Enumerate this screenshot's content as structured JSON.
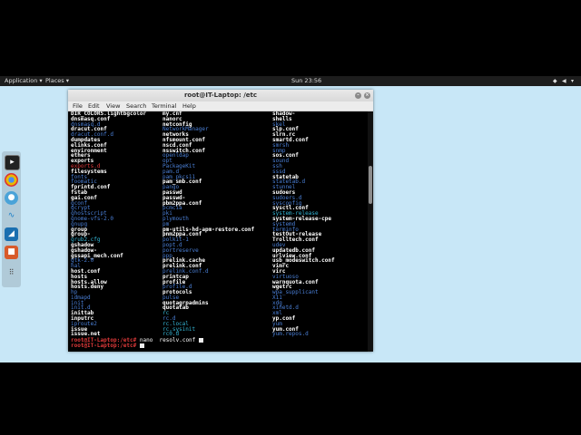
{
  "topbar": {
    "applications": "Application ▾",
    "places": "Places ▾",
    "clock": "Sun 23:56"
  },
  "dock": {
    "icons": [
      "terminal-icon",
      "chrome-icon",
      "app-icon",
      "wave-icon",
      "kali-icon",
      "app2-icon",
      "grid-icon"
    ]
  },
  "window": {
    "title": "root@IT-Laptop: /etc"
  },
  "menu": {
    "file": "File",
    "edit": "Edit",
    "view": "View",
    "search": "Search",
    "terminal": "Terminal",
    "help": "Help"
  },
  "columns": {
    "c1": [
      {
        "t": "DIR_COLORS.lightbgcolor",
        "s": "bold"
      },
      {
        "t": "dnsmasq.conf",
        "s": "bold"
      },
      {
        "t": "dnsmasq.d",
        "s": "blue"
      },
      {
        "t": "dracut.conf",
        "s": "bold"
      },
      {
        "t": "dracut.conf.d",
        "s": "blue"
      },
      {
        "t": "dumpdates",
        "s": "bold"
      },
      {
        "t": "elinks.conf",
        "s": "bold"
      },
      {
        "t": "environment",
        "s": "bold"
      },
      {
        "t": "ethers",
        "s": "bold"
      },
      {
        "t": "exports",
        "s": "bold"
      },
      {
        "t": "exports.d",
        "s": "red"
      },
      {
        "t": "filesystems",
        "s": "bold"
      },
      {
        "t": "fonts",
        "s": "blue"
      },
      {
        "t": "foomatic",
        "s": "blue"
      },
      {
        "t": "fprintd.conf",
        "s": "bold"
      },
      {
        "t": "fstab",
        "s": "bold"
      },
      {
        "t": "gai.conf",
        "s": "bold"
      },
      {
        "t": "gconf",
        "s": "blue"
      },
      {
        "t": "gcrypt",
        "s": "blue"
      },
      {
        "t": "ghostscript",
        "s": "blue"
      },
      {
        "t": "gnome-vfs-2.0",
        "s": "blue"
      },
      {
        "t": "gnupg",
        "s": "blue"
      },
      {
        "t": "group",
        "s": "bold"
      },
      {
        "t": "group-",
        "s": "bold"
      },
      {
        "t": "grub2.cfg",
        "s": "cyan"
      },
      {
        "t": "gshadow",
        "s": "bold"
      },
      {
        "t": "gshadow-",
        "s": "bold"
      },
      {
        "t": "gssapi_mech.conf",
        "s": "bold"
      },
      {
        "t": "gtk-2.0",
        "s": "blue"
      },
      {
        "t": "hal",
        "s": "blue"
      },
      {
        "t": "host.conf",
        "s": "bold"
      },
      {
        "t": "hosts",
        "s": "bold"
      },
      {
        "t": "hosts.allow",
        "s": "bold"
      },
      {
        "t": "hosts.deny",
        "s": "bold"
      },
      {
        "t": "hp",
        "s": "blue"
      },
      {
        "t": "idmapd",
        "s": "blue"
      },
      {
        "t": "init",
        "s": "blue"
      },
      {
        "t": "init.d",
        "s": "blue"
      },
      {
        "t": "inittab",
        "s": "bold"
      },
      {
        "t": "inputrc",
        "s": "bold"
      },
      {
        "t": "iproute2",
        "s": "blue"
      },
      {
        "t": "issue",
        "s": "bold"
      },
      {
        "t": "issue.net",
        "s": "bold"
      }
    ],
    "c2": [
      {
        "t": "my.cnf",
        "s": "bold"
      },
      {
        "t": "nanorc",
        "s": "bold"
      },
      {
        "t": "netconfig",
        "s": "bold"
      },
      {
        "t": "NetworkManager",
        "s": "blue"
      },
      {
        "t": "networks",
        "s": "bold"
      },
      {
        "t": "nfsmount.conf",
        "s": "bold"
      },
      {
        "t": "nscd.conf",
        "s": "bold"
      },
      {
        "t": "nsswitch.conf",
        "s": "bold"
      },
      {
        "t": "openldap",
        "s": "blue"
      },
      {
        "t": "opt",
        "s": "blue"
      },
      {
        "t": "PackageKit",
        "s": "blue"
      },
      {
        "t": "pam.d",
        "s": "blue"
      },
      {
        "t": "pam_pkcs11",
        "s": "blue"
      },
      {
        "t": "pam_smb.conf",
        "s": "bold"
      },
      {
        "t": "pango",
        "s": "blue"
      },
      {
        "t": "passwd",
        "s": "bold"
      },
      {
        "t": "passwd-",
        "s": "bold"
      },
      {
        "t": "pbm2ppa.conf",
        "s": "bold"
      },
      {
        "t": "pcmcia",
        "s": "blue"
      },
      {
        "t": "pki",
        "s": "blue"
      },
      {
        "t": "plymouth",
        "s": "blue"
      },
      {
        "t": "pm",
        "s": "blue"
      },
      {
        "t": "pm-utils-hd-apm-restore.conf",
        "s": "bold"
      },
      {
        "t": "pnm2ppa.conf",
        "s": "bold"
      },
      {
        "t": "polkit-1",
        "s": "blue"
      },
      {
        "t": "popt.d",
        "s": "blue"
      },
      {
        "t": "portreserve",
        "s": "blue"
      },
      {
        "t": "ppp",
        "s": "blue"
      },
      {
        "t": "prelink.cache",
        "s": "bold"
      },
      {
        "t": "prelink.conf",
        "s": "bold"
      },
      {
        "t": "prelink.conf.d",
        "s": "blue"
      },
      {
        "t": "printcap",
        "s": "bold"
      },
      {
        "t": "profile",
        "s": "bold"
      },
      {
        "t": "profile.d",
        "s": "blue"
      },
      {
        "t": "protocols",
        "s": "bold"
      },
      {
        "t": "pulse",
        "s": "blue"
      },
      {
        "t": "quotagrpadmins",
        "s": "bold"
      },
      {
        "t": "quotatab",
        "s": "bold"
      },
      {
        "t": "rc",
        "s": "cyan"
      },
      {
        "t": "rc.d",
        "s": "blue"
      },
      {
        "t": "rc.local",
        "s": "cyan"
      },
      {
        "t": "rc.sysinit",
        "s": "cyan"
      },
      {
        "t": "rc0.d",
        "s": "cyan"
      }
    ],
    "c3": [
      {
        "t": "shadow-",
        "s": "bold"
      },
      {
        "t": "shells",
        "s": "bold"
      },
      {
        "t": "skel",
        "s": "blue"
      },
      {
        "t": "slp.conf",
        "s": "bold"
      },
      {
        "t": "slrn.rc",
        "s": "bold"
      },
      {
        "t": "smartd.conf",
        "s": "bold"
      },
      {
        "t": "smrsh",
        "s": "blue"
      },
      {
        "t": "snmp",
        "s": "blue"
      },
      {
        "t": "sos.conf",
        "s": "bold"
      },
      {
        "t": "sound",
        "s": "blue"
      },
      {
        "t": "ssh",
        "s": "blue"
      },
      {
        "t": "sssd",
        "s": "blue"
      },
      {
        "t": "statetab",
        "s": "bold"
      },
      {
        "t": "statetab.d",
        "s": "blue"
      },
      {
        "t": "stunnel",
        "s": "blue"
      },
      {
        "t": "sudoers",
        "s": "bold"
      },
      {
        "t": "sudoers.d",
        "s": "blue"
      },
      {
        "t": "sysconfig",
        "s": "blue"
      },
      {
        "t": "sysctl.conf",
        "s": "bold"
      },
      {
        "t": "system-release",
        "s": "cyan"
      },
      {
        "t": "system-release-cpe",
        "s": "bold"
      },
      {
        "t": "systemd",
        "s": "blue"
      },
      {
        "t": "terminfo",
        "s": "blue"
      },
      {
        "t": "testOut-release",
        "s": "bold"
      },
      {
        "t": "Trolltech.conf",
        "s": "bold"
      },
      {
        "t": "udev",
        "s": "blue"
      },
      {
        "t": "updatedb.conf",
        "s": "bold"
      },
      {
        "t": "urlview.conf",
        "s": "bold"
      },
      {
        "t": "usb_modeswitch.conf",
        "s": "bold"
      },
      {
        "t": "vimrc",
        "s": "bold"
      },
      {
        "t": "virc",
        "s": "bold"
      },
      {
        "t": "virtuoso",
        "s": "blue"
      },
      {
        "t": "warnquota.conf",
        "s": "bold"
      },
      {
        "t": "wgetrc",
        "s": "bold"
      },
      {
        "t": "wpa_supplicant",
        "s": "blue"
      },
      {
        "t": "X11",
        "s": "blue"
      },
      {
        "t": "xdg",
        "s": "blue"
      },
      {
        "t": "xinetd.d",
        "s": "blue"
      },
      {
        "t": "xml",
        "s": "blue"
      },
      {
        "t": "yp.conf",
        "s": "bold"
      },
      {
        "t": "yum",
        "s": "blue"
      },
      {
        "t": "yum.conf",
        "s": "bold"
      },
      {
        "t": "yum.repos.d",
        "s": "blue"
      }
    ]
  },
  "prompt": {
    "user": "root@IT-Laptop",
    "path": ":/etc# ",
    "command": "nano  resolv.conf "
  }
}
